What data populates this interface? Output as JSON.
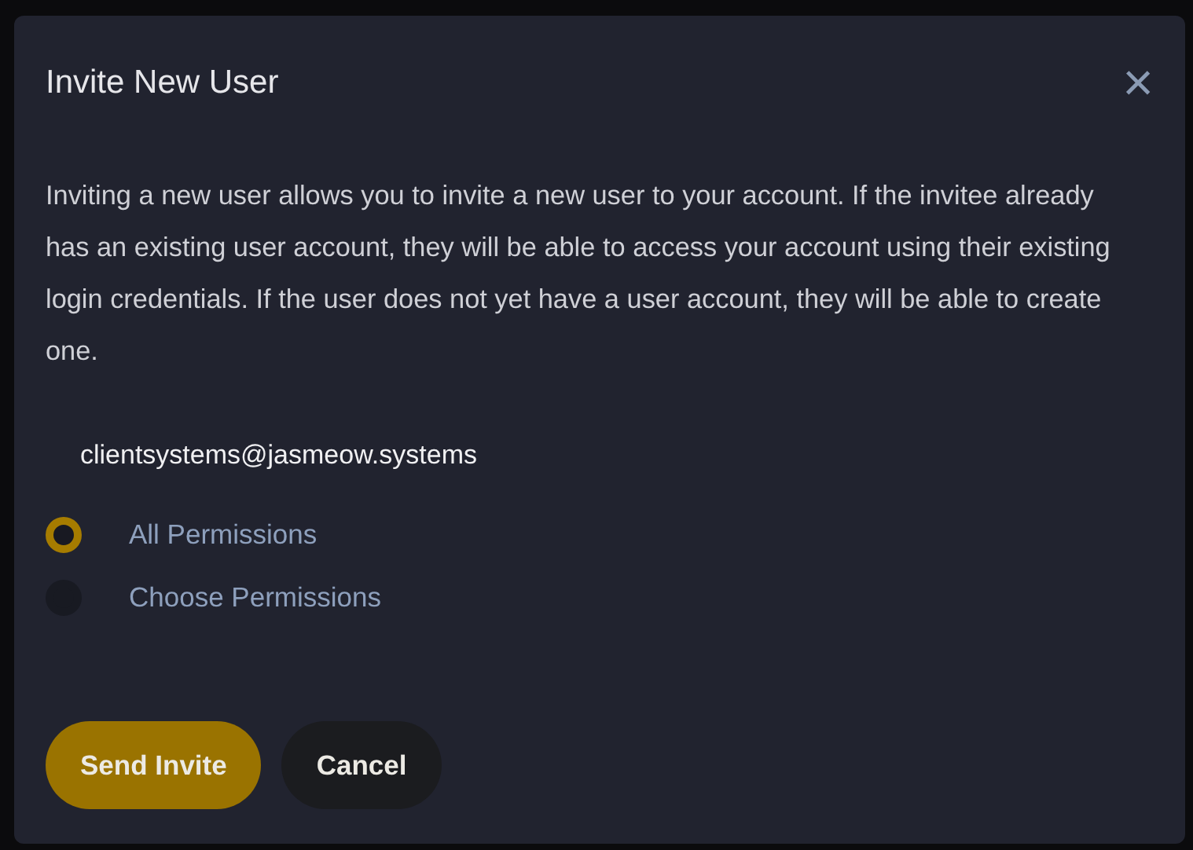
{
  "dialog": {
    "title": "Invite New User",
    "close": "×",
    "description": "Inviting a new user allows you to invite a new user to your account. If the invitee already has an existing user account, they will be able to access your account using their existing login credentials. If the user does not yet have a user account, they will be able to create one.",
    "email": "clientsystems@jasmeow.systems",
    "permissions": [
      {
        "label": "All Permissions",
        "selected": true
      },
      {
        "label": "Choose Permissions",
        "selected": false
      }
    ],
    "buttons": [
      {
        "label": "Send Invite",
        "kind": "primary"
      },
      {
        "label": "Cancel",
        "kind": "secondary"
      }
    ]
  }
}
